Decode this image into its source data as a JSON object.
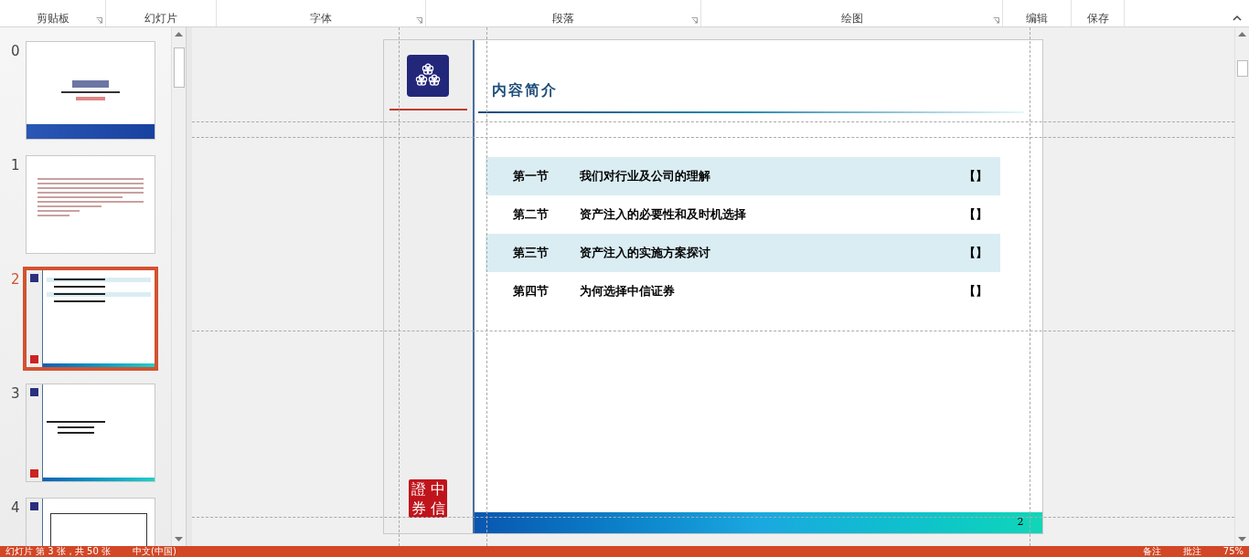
{
  "ribbon": {
    "groups": [
      {
        "label": "剪贴板",
        "launcher": true
      },
      {
        "label": "幻灯片",
        "launcher": false
      },
      {
        "label": "字体",
        "launcher": true
      },
      {
        "label": "段落",
        "launcher": true
      },
      {
        "label": "绘图",
        "launcher": true
      },
      {
        "label": "编辑",
        "launcher": false
      },
      {
        "label": "保存",
        "launcher": false
      }
    ]
  },
  "thumbnails": [
    {
      "number": "0",
      "kind": "cover",
      "selected": false
    },
    {
      "number": "1",
      "kind": "letter",
      "selected": false
    },
    {
      "number": "2",
      "kind": "toc",
      "selected": true
    },
    {
      "number": "3",
      "kind": "content",
      "selected": false
    },
    {
      "number": "4",
      "kind": "table",
      "selected": false
    }
  ],
  "slide": {
    "title": "内容简介",
    "seal": [
      "證",
      "中",
      "券",
      "信"
    ],
    "page_number": "2",
    "rows": [
      {
        "section": "第一节",
        "title": "我们对行业及公司的理解",
        "mark": "【】",
        "shaded": true
      },
      {
        "section": "第二节",
        "title": "资产注入的必要性和及时机选择",
        "mark": "【】",
        "shaded": false
      },
      {
        "section": "第三节",
        "title": "资产注入的实施方案探讨",
        "mark": "【】",
        "shaded": true
      },
      {
        "section": "第四节",
        "title": "为何选择中信证券",
        "mark": "【】",
        "shaded": false
      }
    ]
  },
  "status_bar": {
    "slide_info": "幻灯片 第 3 张，共 50 张",
    "language": "中文(中国)",
    "notes": "备注",
    "comments": "批注",
    "zoom": "75%"
  }
}
